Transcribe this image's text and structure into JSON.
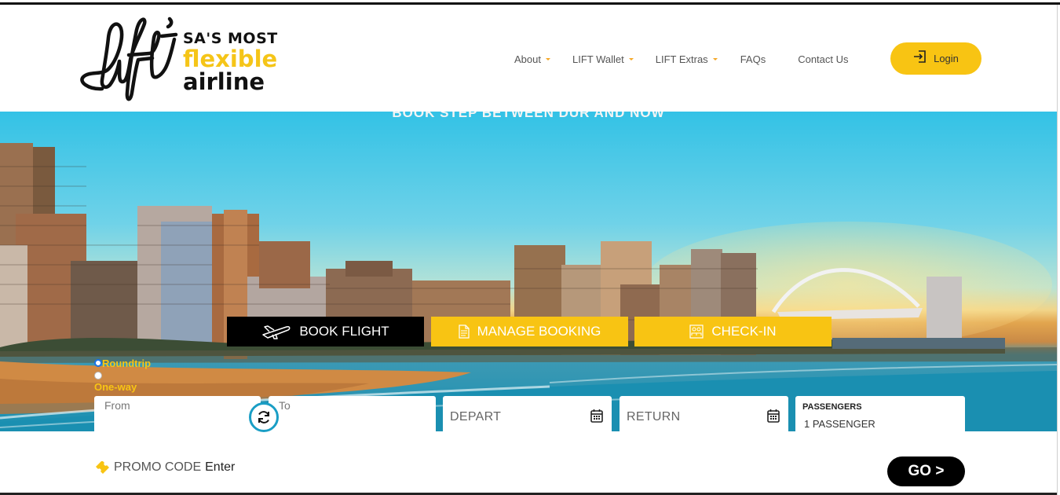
{
  "brand": {
    "tagline_line1": "SA'S MOST",
    "tagline_line2": "flexible",
    "tagline_line3": "airline",
    "accent_color": "#f8c413"
  },
  "nav": {
    "items": [
      {
        "label": "About",
        "has_dropdown": true
      },
      {
        "label": "LIFT Wallet",
        "has_dropdown": true
      },
      {
        "label": "LIFT Extras",
        "has_dropdown": true
      },
      {
        "label": "FAQs",
        "has_dropdown": false
      },
      {
        "label": "Contact Us",
        "has_dropdown": false
      }
    ],
    "login_label": "Login",
    "login_icon": "login-icon"
  },
  "hero": {
    "title": "BOOK STEP BETWEEN DUR  AND NOW"
  },
  "tabs": [
    {
      "label": "BOOK FLIGHT",
      "icon": "plane-icon",
      "active": true
    },
    {
      "label": "MANAGE BOOKING",
      "icon": "document-icon",
      "active": false
    },
    {
      "label": "CHECK-IN",
      "icon": "checkin-icon",
      "active": false
    }
  ],
  "trip_type": {
    "options": [
      "Roundtrip",
      "One-way"
    ],
    "selected": "Roundtrip"
  },
  "search": {
    "from_placeholder": "From",
    "to_placeholder": "To",
    "depart_placeholder": "DEPART",
    "return_placeholder": "RETURN",
    "passengers_label": "PASSENGERS",
    "passengers_value": "1 PASSENGER"
  },
  "promo": {
    "label": "PROMO CODE",
    "enter_label": "Enter"
  },
  "go_label": "GO >"
}
